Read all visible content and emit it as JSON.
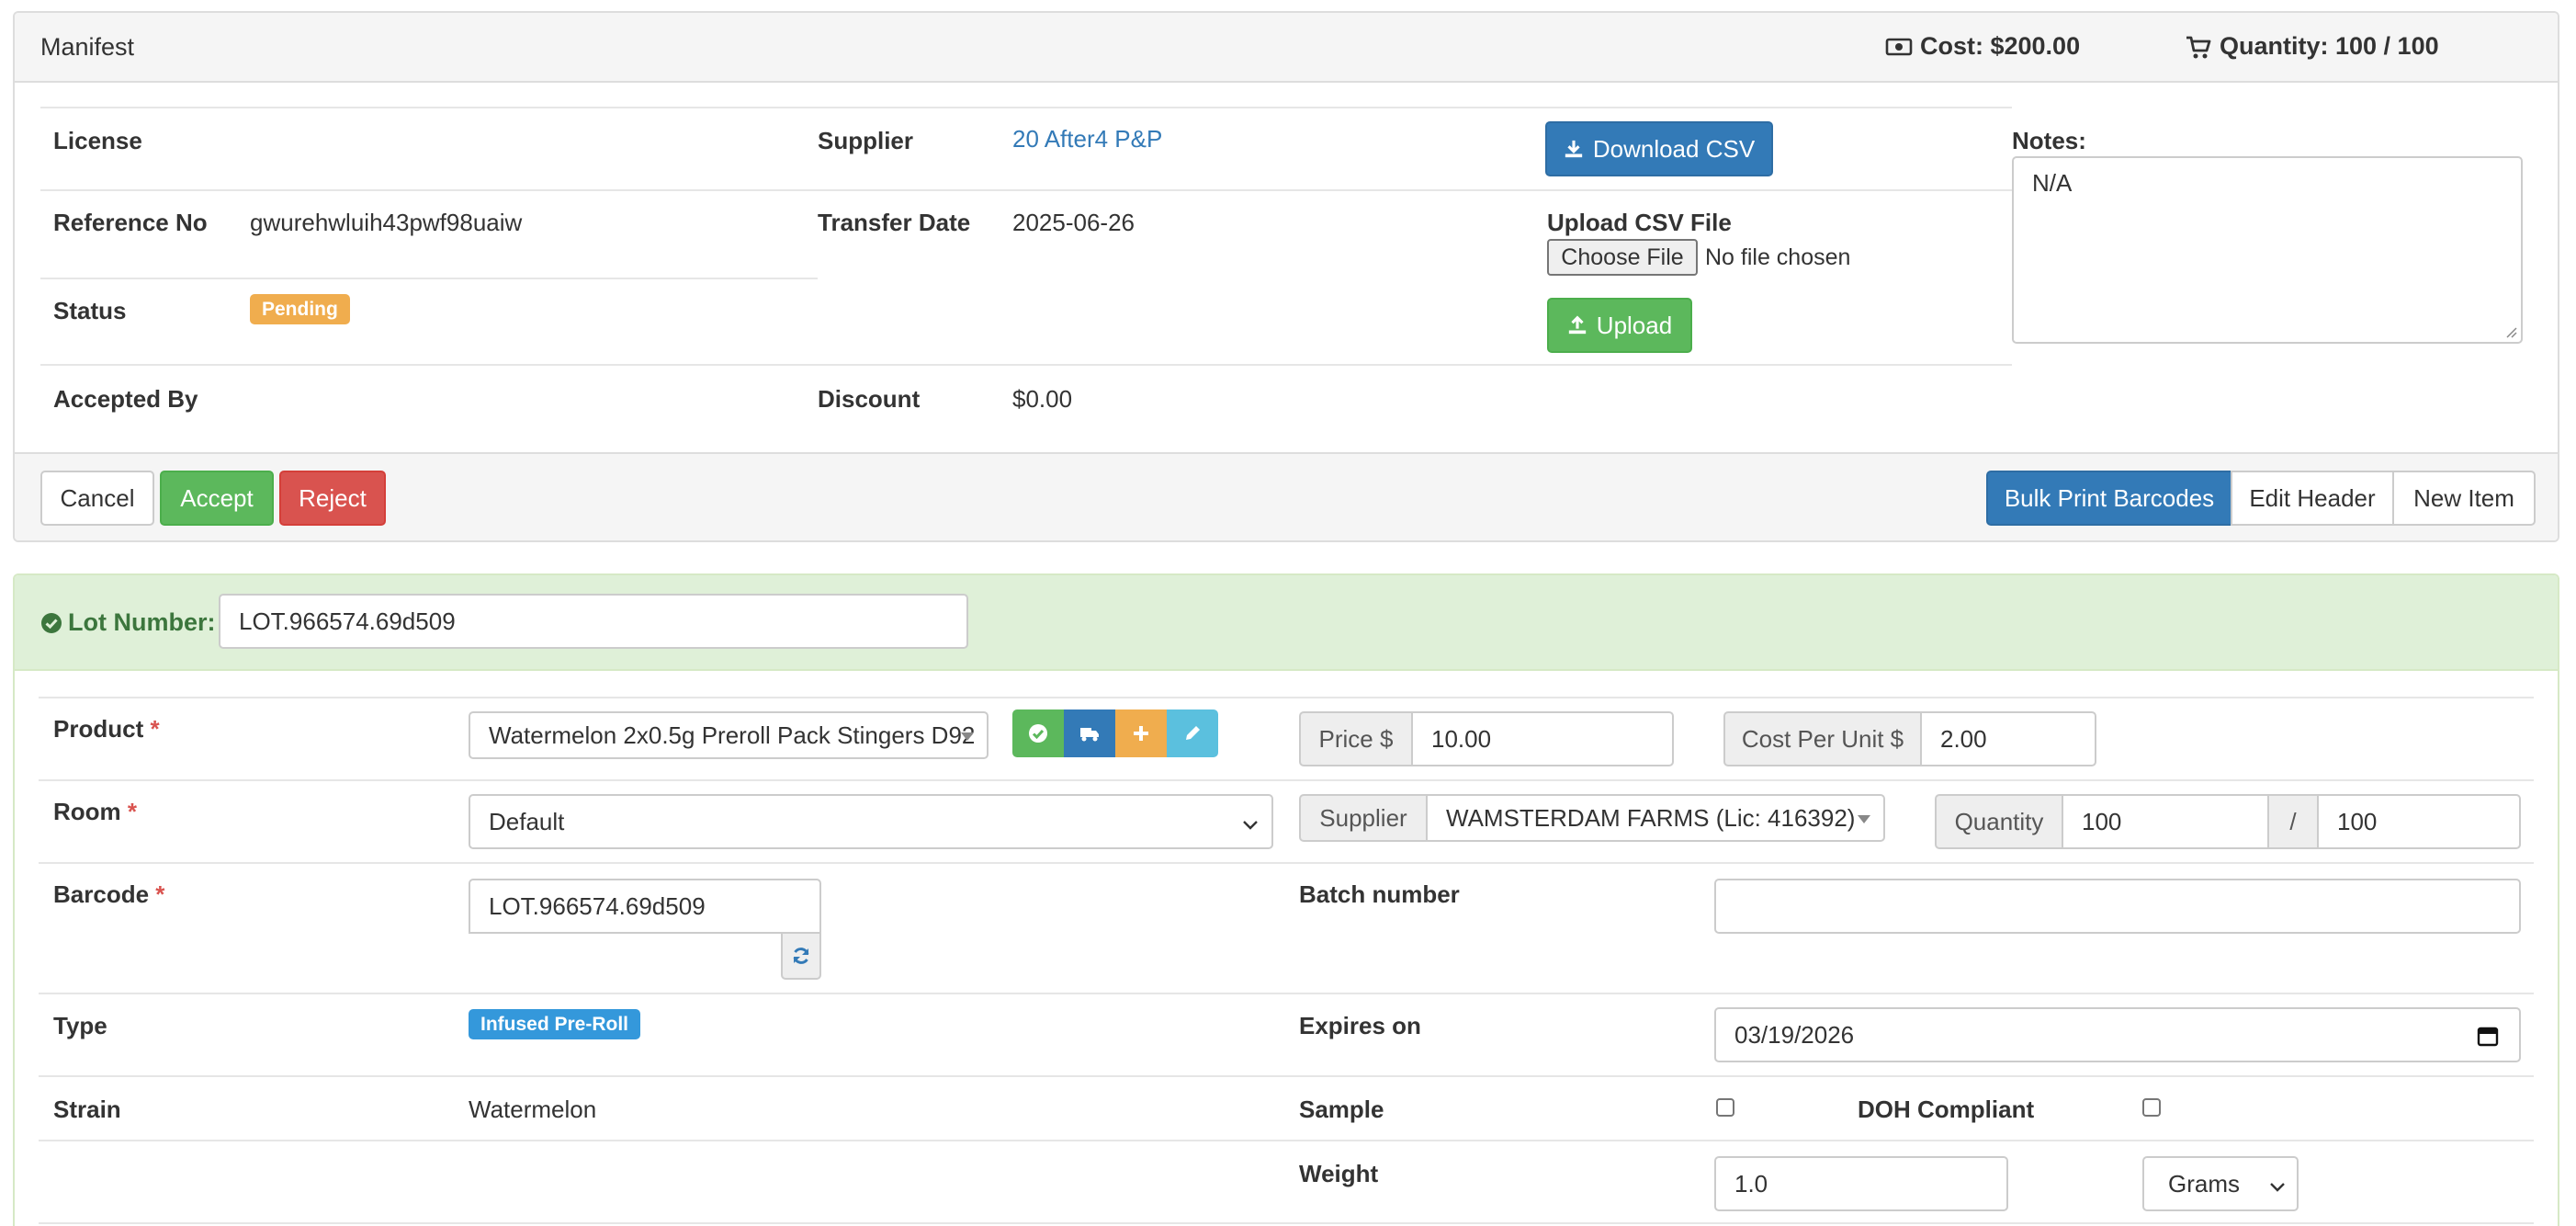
{
  "manifest": {
    "title": "Manifest",
    "cost": "Cost: $200.00",
    "quantity": "Quantity: 100 / 100",
    "license_label": "License",
    "license_value": "",
    "reference_label": "Reference No",
    "reference_value": "gwurehwluih43pwf98uaiw",
    "status_label": "Status",
    "status_value": "Pending",
    "accepted_by_label": "Accepted By",
    "accepted_by_value": "",
    "supplier_label": "Supplier",
    "supplier_value": "20 After4 P&P",
    "transfer_date_label": "Transfer Date",
    "transfer_date_value": "2025-06-26",
    "discount_label": "Discount",
    "discount_value": "$0.00",
    "download_csv": "Download CSV",
    "upload_csv_label": "Upload CSV File",
    "choose_file": "Choose File",
    "no_file": "No file chosen",
    "upload": "Upload",
    "notes_label": "Notes:",
    "notes_value": "N/A"
  },
  "actions": {
    "cancel": "Cancel",
    "accept": "Accept",
    "reject": "Reject",
    "bulk_print": "Bulk Print Barcodes",
    "edit_header": "Edit Header",
    "new_item": "New Item"
  },
  "lot": {
    "label": "Lot Number:",
    "value": "LOT.966574.69d509"
  },
  "item": {
    "product_label": "Product",
    "product_value": "Watermelon 2x0.5g Preroll Pack Stingers D92",
    "price_label": "Price $",
    "price_value": "10.00",
    "cost_label": "Cost Per Unit $",
    "cost_value": "2.00",
    "room_label": "Room",
    "room_value": "Default",
    "supplier_label": "Supplier",
    "supplier_value": "WAMSTERDAM FARMS (Lic: 416392)",
    "quantity_label": "Quantity",
    "quantity_value": "100",
    "quantity_sep": "/",
    "quantity_total": "100",
    "barcode_label": "Barcode",
    "barcode_value": "LOT.966574.69d509",
    "batch_label": "Batch number",
    "batch_value": "",
    "type_label": "Type",
    "type_value": "Infused Pre-Roll",
    "expires_label": "Expires on",
    "expires_value": "03/19/2026",
    "strain_label": "Strain",
    "strain_value": "Watermelon",
    "sample_label": "Sample",
    "doh_label": "DOH Compliant",
    "weight_label": "Weight",
    "weight_value": "1.0",
    "weight_unit": "Grams",
    "required_mark": "*"
  },
  "colors": {
    "primary": "#337ab7",
    "success": "#5cb85c",
    "danger": "#d9534f",
    "warning": "#f0ad4e",
    "info": "#5bc0de",
    "badge_type": "#3498db"
  },
  "icons": {
    "cost": "money-icon",
    "quantity": "cart-icon",
    "download": "download-icon",
    "upload": "upload-icon",
    "lot_ok": "check-circle-icon",
    "refresh": "refresh-icon"
  }
}
